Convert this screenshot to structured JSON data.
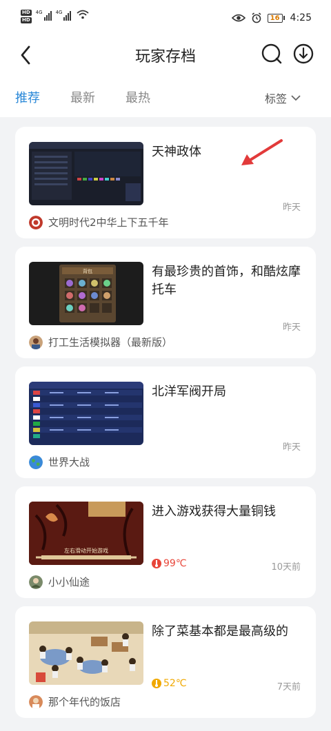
{
  "status_bar": {
    "hd1": "HD",
    "hd2": "HD",
    "net1": "4G",
    "net2": "4G",
    "battery": "16",
    "time": "4:25"
  },
  "header": {
    "title": "玩家存档",
    "icons": [
      "back-icon",
      "search-icon",
      "download-icon"
    ]
  },
  "tabs": [
    {
      "label": "推荐",
      "active": true
    },
    {
      "label": "最新",
      "active": false
    },
    {
      "label": "最热",
      "active": false
    }
  ],
  "tag_filter": "标签",
  "cards": [
    {
      "title": "天神政体",
      "time": "昨天",
      "game": "文明时代2中华上下五千年",
      "heat": ""
    },
    {
      "title": "有最珍贵的首饰，和酷炫摩托车",
      "time": "昨天",
      "game": "打工生活模拟器（最新版）",
      "heat": ""
    },
    {
      "title": "北洋军阀开局",
      "time": "昨天",
      "game": "世界大战",
      "heat": ""
    },
    {
      "title": "进入游戏获得大量铜钱",
      "time": "10天前",
      "game": "小小仙途",
      "heat": "99℃"
    },
    {
      "title": "除了菜基本都是最高级的",
      "time": "7天前",
      "game": "那个年代的饭店",
      "heat": "52℃"
    }
  ],
  "thumb_texts": {
    "card2_inventory": "背包",
    "card4_banner": "左右滑动开始游戏"
  },
  "colors": {
    "accent": "#2a88d8",
    "heat_hot": "#e8463a",
    "heat_warm": "#f0a800",
    "annotation_arrow": "#e23a3a"
  }
}
